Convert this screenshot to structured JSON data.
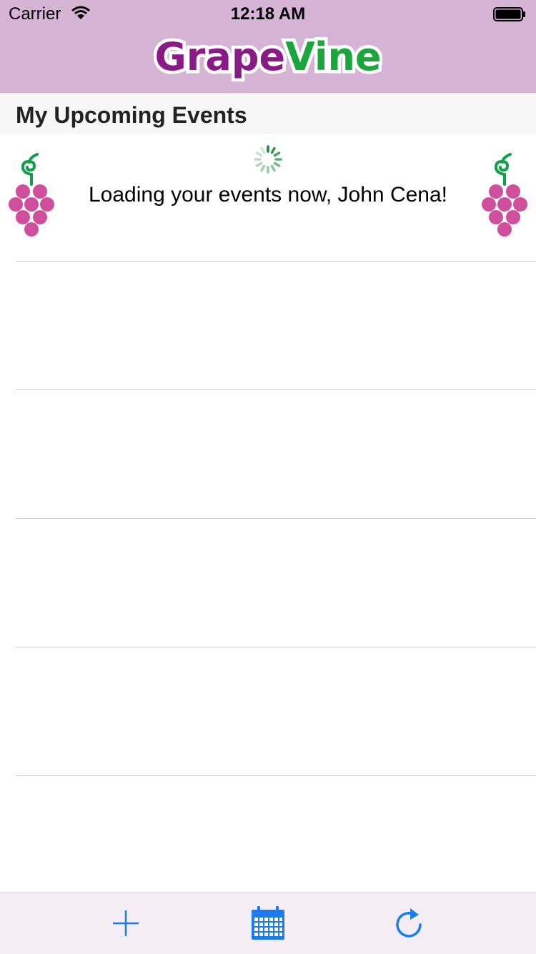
{
  "status_bar": {
    "carrier": "Carrier",
    "time": "12:18 AM"
  },
  "app": {
    "title": "GrapeVine"
  },
  "section": {
    "title": "My Upcoming Events"
  },
  "loading": {
    "message": "Loading your events now, John Cena!"
  },
  "colors": {
    "nav_bg": "#d6b4d6",
    "grape": "#cf4f9c",
    "stem": "#11a04a",
    "accent": "#1a7cf0",
    "logo_purple": "#8a1a86",
    "logo_green": "#1aa63a"
  },
  "tab_bar": {
    "items": [
      "add-icon",
      "calendar-icon",
      "refresh-icon"
    ]
  }
}
